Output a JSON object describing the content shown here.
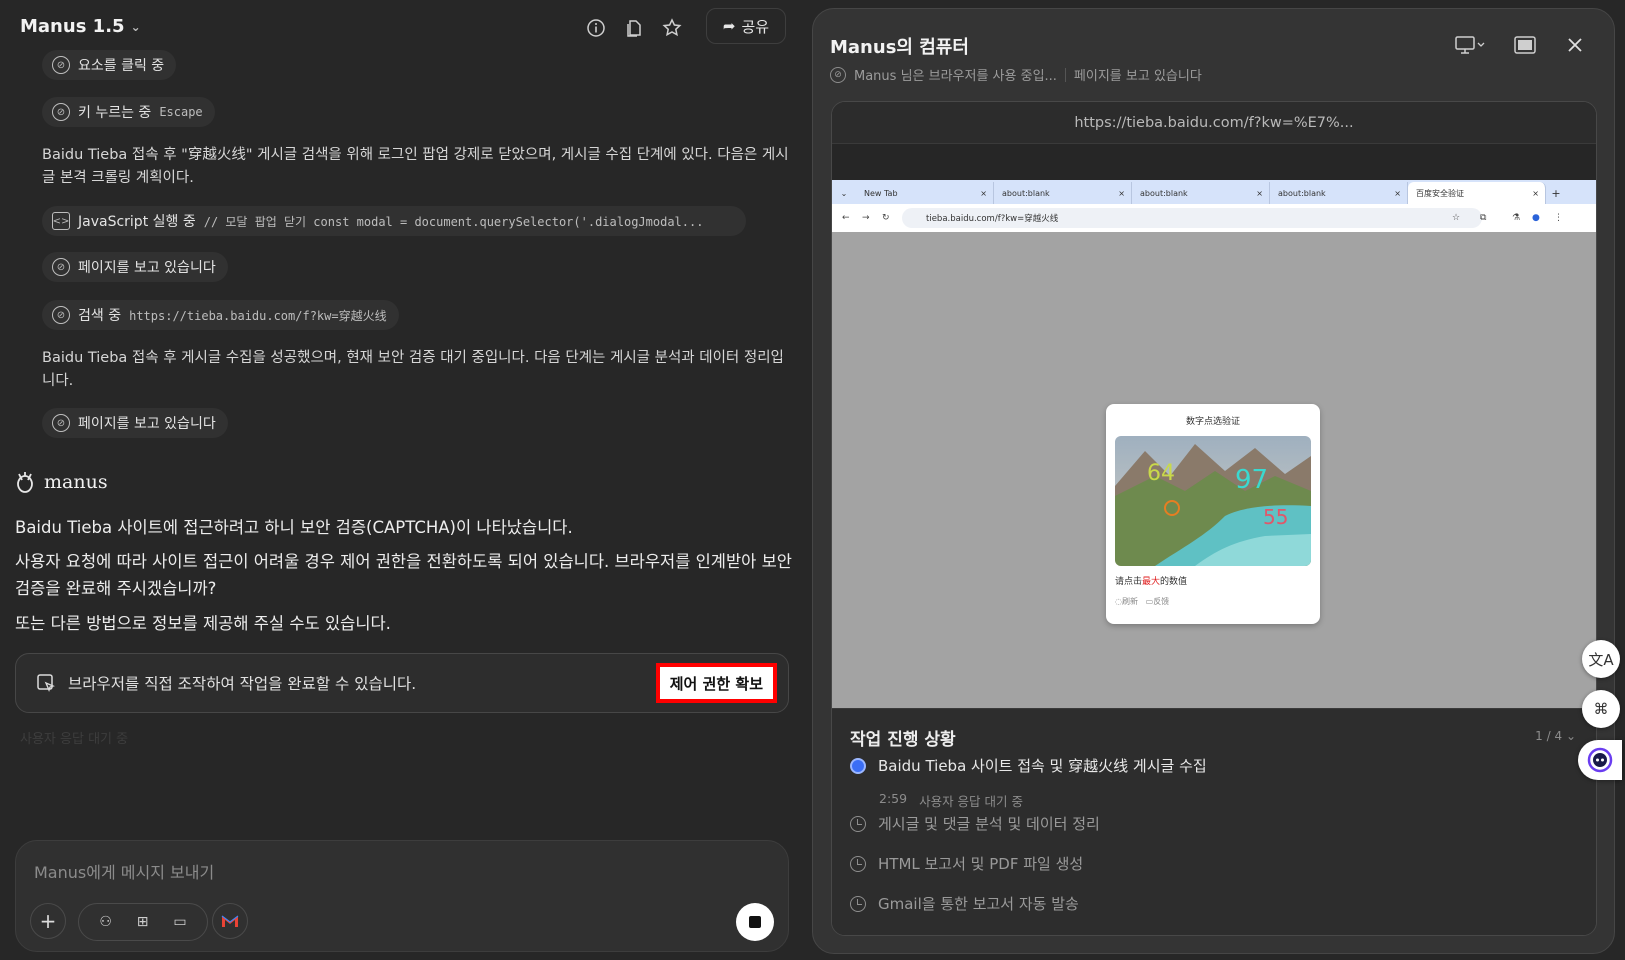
{
  "header": {
    "brand": "Manus 1.5",
    "share_label": "공유"
  },
  "activity": [
    {
      "label": "요소를 클릭 중",
      "detail": ""
    },
    {
      "label": "키 누르는 중",
      "detail": "Escape"
    }
  ],
  "note1": "Baidu Tieba 접속 후 \"穿越火线\" 게시글 검색을 위해 로그인 팝업 강제로 닫았으며, 게시글 수집 단계에 있다. 다음은 게시글 본격 크롤링 계획이다.",
  "activity2": [
    {
      "label": "JavaScript 실행 중",
      "detail": "// 모달 팝업 닫기 const modal = document.querySelector('.dialogJmodal..."
    },
    {
      "label": "페이지를 보고 있습니다",
      "detail": ""
    },
    {
      "label": "검색 중",
      "detail": "https://tieba.baidu.com/f?kw=穿越火线"
    }
  ],
  "note2": "Baidu Tieba 접속 후 게시글 수집을 성공했으며, 현재 보안 검증 대기 중입니다. 다음 단계는 게시글 분석과 데이터 정리입니다.",
  "activity3": {
    "label": "페이지를 보고 있습니다"
  },
  "assistant": {
    "name": "manus",
    "lines": [
      "Baidu Tieba 사이트에 접근하려고 하니 보안 검증(CAPTCHA)이 나타났습니다.",
      "사용자 요청에 따라 사이트 접근이 어려울 경우 제어 권한을 전환하도록 되어 있습니다. 브라우저를 인계받아 보안 검증을 완료해 주시겠습니까?",
      "또는 다른 방법으로 정보를 제공해 주실 수도 있습니다."
    ]
  },
  "control": {
    "text": "브라우저를 직접 조작하여 작업을 완료할 수 있습니다.",
    "button": "제어 권한 확보"
  },
  "ghost_status": "사용자 응답 대기 중",
  "composer": {
    "placeholder": "Manus에게 메시지 보내기"
  },
  "computer": {
    "title": "Manus의 컴퓨터",
    "status_left": "Manus 님은 브라우저를 사용 중입...",
    "status_right": "페이지를 보고 있습니다",
    "url": "https://tieba.baidu.com/f?kw=%E7%..."
  },
  "browser": {
    "tabs": [
      "New Tab",
      "about:blank",
      "about:blank",
      "about:blank",
      "百度安全验证"
    ],
    "address": "tieba.baidu.com/f?kw=穿越火线",
    "captcha": {
      "title": "数字点选验证",
      "hint_pre": "请点击",
      "hint_emph": "最大",
      "hint_post": "的数值",
      "refresh": "刷新",
      "feedback": "反馈",
      "numbers": [
        "64",
        "97",
        "55"
      ]
    }
  },
  "progress": {
    "title": "작업 진행 상황",
    "count": "1 / 4",
    "current": {
      "label": "Baidu Tieba 사이트 접속 및 穿越火线 게시글 수집",
      "time": "2:59",
      "status": "사용자 응답 대기 중"
    },
    "pending": [
      "게시글 및 댓글 분석 및 데이터 정리",
      "HTML 보고서 및 PDF 파일 생성",
      "Gmail을 통한 보고서 자동 발송"
    ]
  },
  "colors": {
    "accent_red": "#ff0000",
    "step_blue": "#3b6ef5"
  }
}
